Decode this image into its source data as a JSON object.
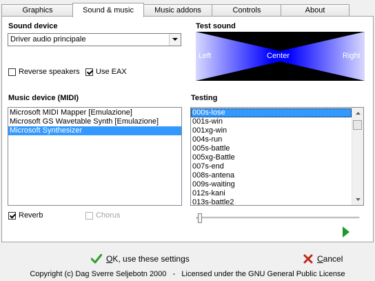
{
  "tabs": [
    {
      "label": "Graphics"
    },
    {
      "label": "Sound & music"
    },
    {
      "label": "Music addons"
    },
    {
      "label": "Controls"
    },
    {
      "label": "About"
    }
  ],
  "active_tab": "Sound & music",
  "sound_device": {
    "label": "Sound device",
    "selected": "Driver audio principale"
  },
  "reverse_speakers": {
    "label": "Reverse speakers",
    "checked": false
  },
  "use_eax": {
    "label": "Use EAX",
    "checked": true
  },
  "test_sound": {
    "label": "Test sound",
    "left": "Left",
    "center": "Center",
    "right": "Right"
  },
  "music_device": {
    "label": "Music device (MIDI)",
    "items": [
      {
        "text": "Microsoft MIDI Mapper [Emulazione]"
      },
      {
        "text": "Microsoft GS Wavetable Synth [Emulazione]"
      },
      {
        "text": "Microsoft Synthesizer"
      }
    ],
    "selected": "Microsoft Synthesizer"
  },
  "testing": {
    "label": "Testing",
    "items": [
      {
        "text": "000s-lose"
      },
      {
        "text": "001s-win"
      },
      {
        "text": "001xg-win"
      },
      {
        "text": "004s-run"
      },
      {
        "text": "005s-battle"
      },
      {
        "text": "005xg-Battle"
      },
      {
        "text": "007s-end"
      },
      {
        "text": "008s-antena"
      },
      {
        "text": "009s-waiting"
      },
      {
        "text": "012s-kani"
      },
      {
        "text": "013s-battle2"
      }
    ],
    "selected": "000s-lose",
    "position": 0
  },
  "reverb": {
    "label": "Reverb",
    "checked": true
  },
  "chorus": {
    "label": "Chorus",
    "checked": false,
    "enabled": false
  },
  "buttons": {
    "ok_label": "OK, use these settings",
    "ok_accel": "O",
    "ok_rest": "K, use these settings",
    "cancel_label": "Cancel",
    "cancel_accel": "C",
    "cancel_rest": "ancel"
  },
  "footer": "Copyright (c) Dag Sverre Seljebotn 2000   -   Licensed under the GNU General Public License",
  "colors": {
    "selection": "#3399ff",
    "play_arrow": "#1a9a2a",
    "ok_check": "#2e9e2e",
    "cancel_x": "#c0281c",
    "sound_blue": "#0000ff"
  }
}
